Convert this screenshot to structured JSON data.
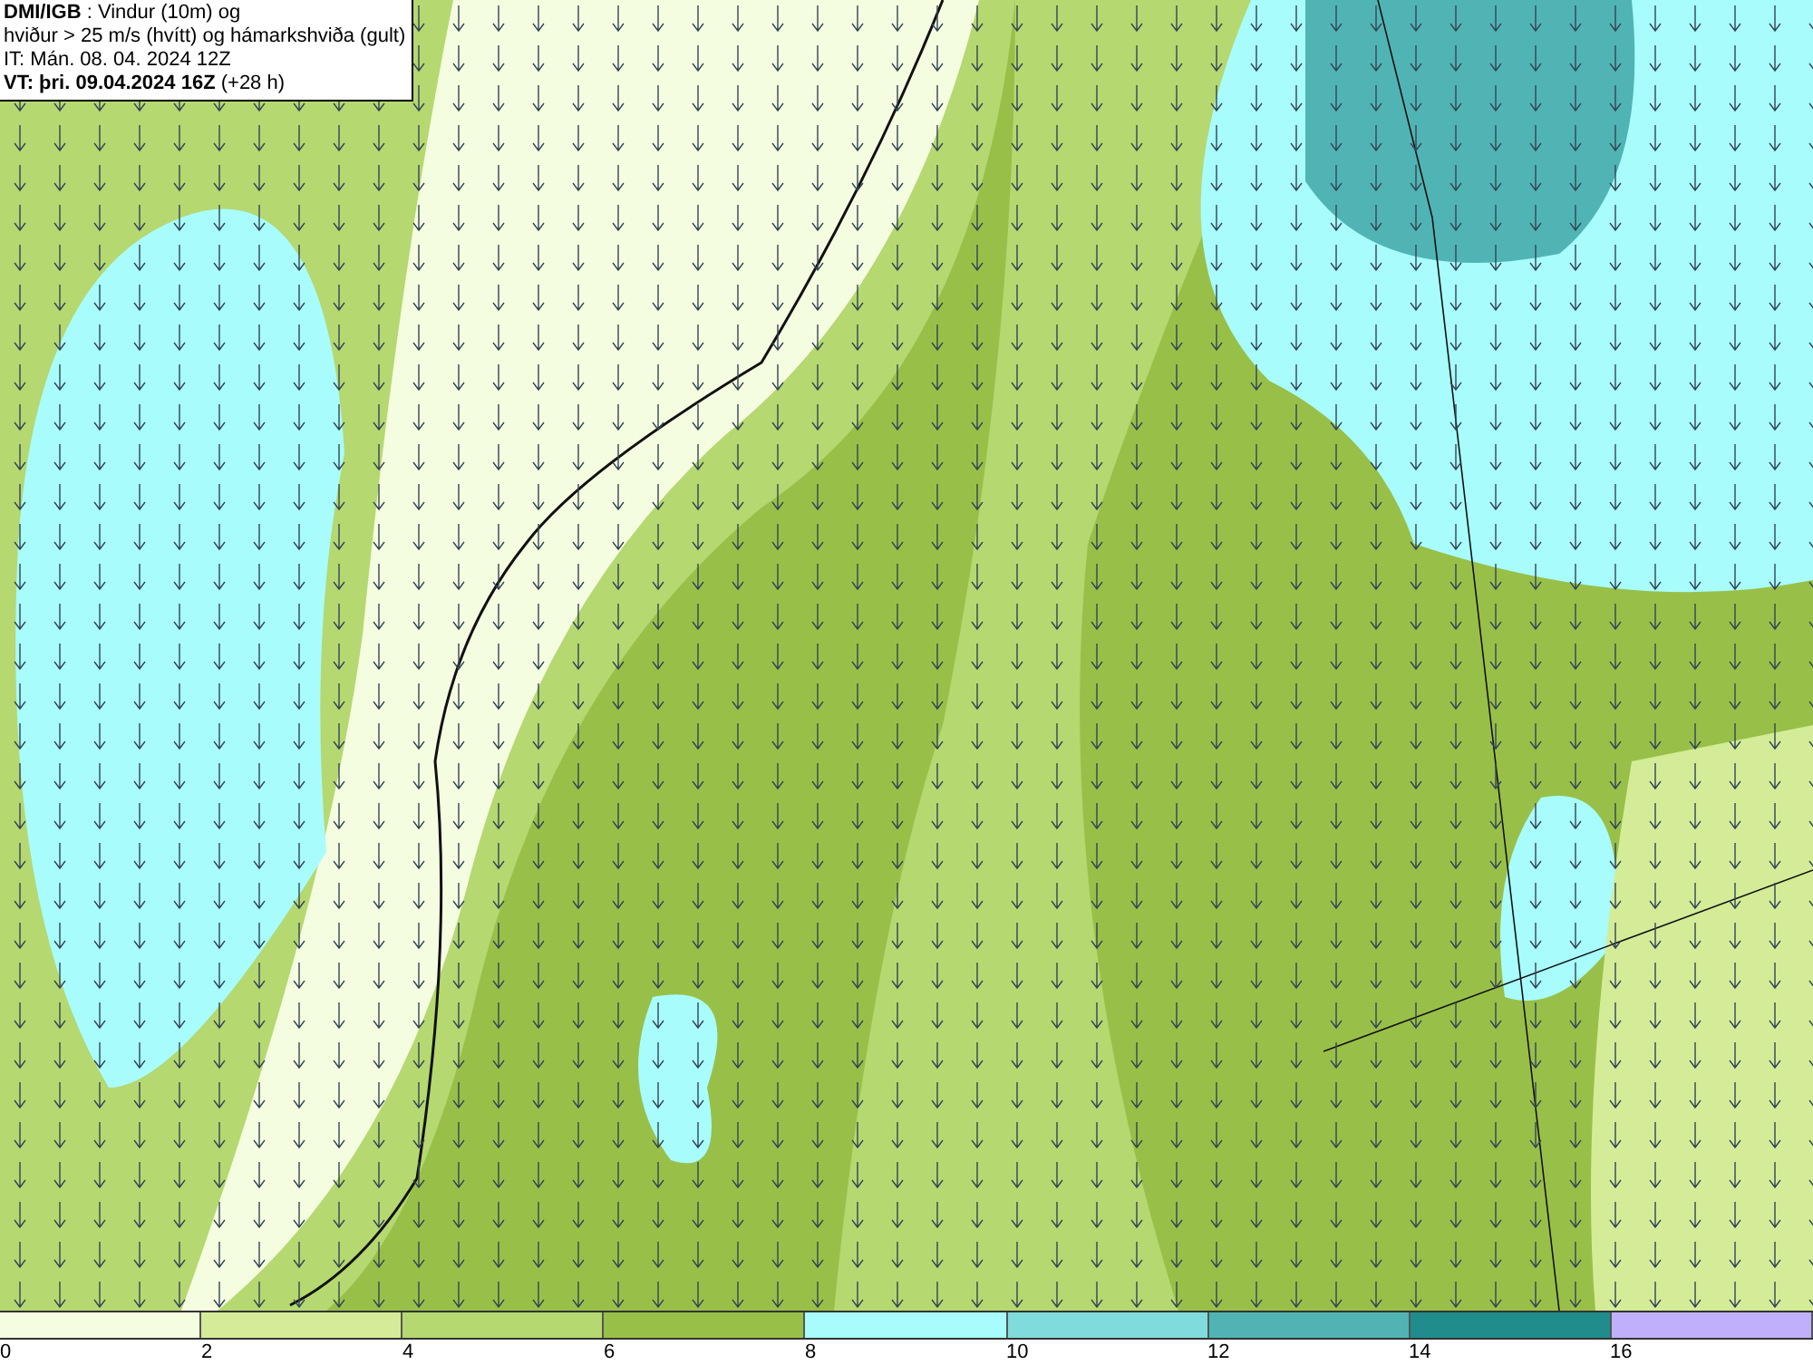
{
  "header": {
    "lines": [
      "**DMI/IGB** : Vindur (10m) og",
      "hviður > 25 m/s (hvítt) og hámarkshviða (gult)",
      "IT: Mán. 08. 04. 2024 12Z",
      "**VT: þri. 09.04.2024 16Z** (+28 h)"
    ]
  },
  "legend": {
    "bins": [
      {
        "color": "#f5fde0"
      },
      {
        "color": "#d4ec98"
      },
      {
        "color": "#b5d870"
      },
      {
        "color": "#98c048"
      },
      {
        "color": "#a8fcfc"
      },
      {
        "color": "#80dcdc"
      },
      {
        "color": "#50b4b4"
      },
      {
        "color": "#208c8c"
      },
      {
        "color": "#c0b0fc"
      }
    ],
    "ticks": [
      "0",
      "2",
      "4",
      "6",
      "8",
      "10",
      "12",
      "14",
      "16"
    ]
  }
}
